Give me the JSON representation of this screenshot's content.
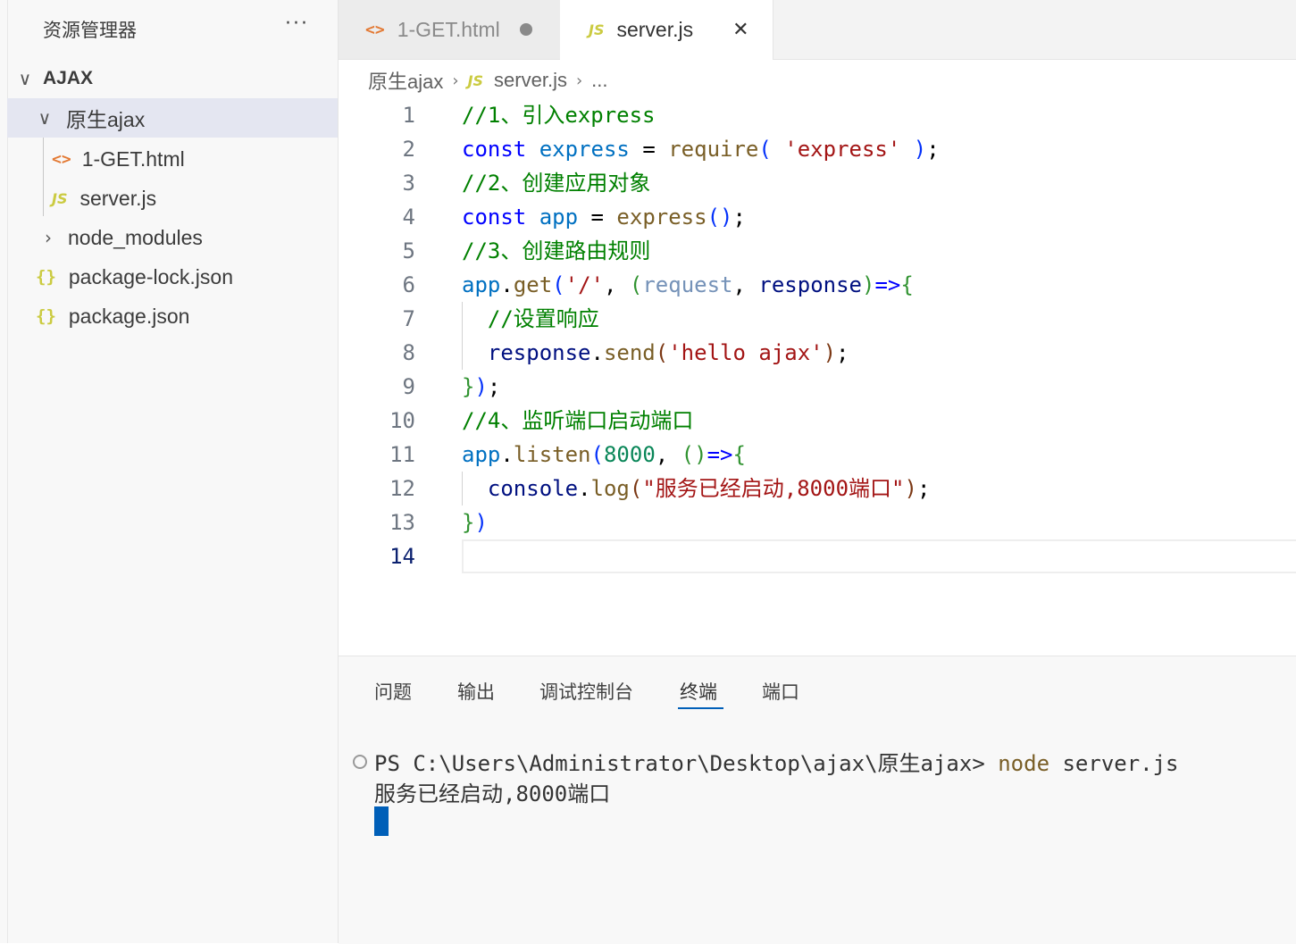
{
  "sidebar": {
    "title": "资源管理器",
    "more_label": "···",
    "root": "AJAX",
    "items": [
      {
        "label": "原生ajax",
        "type": "folder",
        "expanded": true
      },
      {
        "label": "1-GET.html",
        "type": "html"
      },
      {
        "label": "server.js",
        "type": "js"
      },
      {
        "label": "node_modules",
        "type": "folder",
        "expanded": false
      },
      {
        "label": "package-lock.json",
        "type": "json"
      },
      {
        "label": "package.json",
        "type": "json"
      }
    ]
  },
  "icons": {
    "html": "<>",
    "js": "JS",
    "json": "{}",
    "chevron_down": "∨",
    "chevron_right": "›",
    "close": "✕"
  },
  "tabs": [
    {
      "label": "1-GET.html",
      "icon": "<>",
      "modified": true
    },
    {
      "label": "server.js",
      "icon": "JS",
      "active": true
    }
  ],
  "breadcrumb": {
    "folder": "原生ajax",
    "file": "server.js",
    "tail": "..."
  },
  "editor": {
    "line_numbers": [
      "1",
      "2",
      "3",
      "4",
      "5",
      "6",
      "7",
      "8",
      "9",
      "10",
      "11",
      "12",
      "13",
      "14"
    ],
    "current_line": "14"
  },
  "panel": {
    "tabs": [
      "问题",
      "输出",
      "调试控制台",
      "终端",
      "端口"
    ],
    "active_tab": "终端",
    "terminal": {
      "prompt": "PS C:\\Users\\Administrator\\Desktop\\ajax\\原生ajax> ",
      "command_name": "node",
      "command_args": " server.js",
      "output": "服务已经启动,8000端口"
    }
  },
  "colors": {
    "accent": "#005fb8",
    "selected_row": "#e4e6f1",
    "comment": "#008000",
    "keyword": "#0000ff",
    "string": "#a31515"
  }
}
